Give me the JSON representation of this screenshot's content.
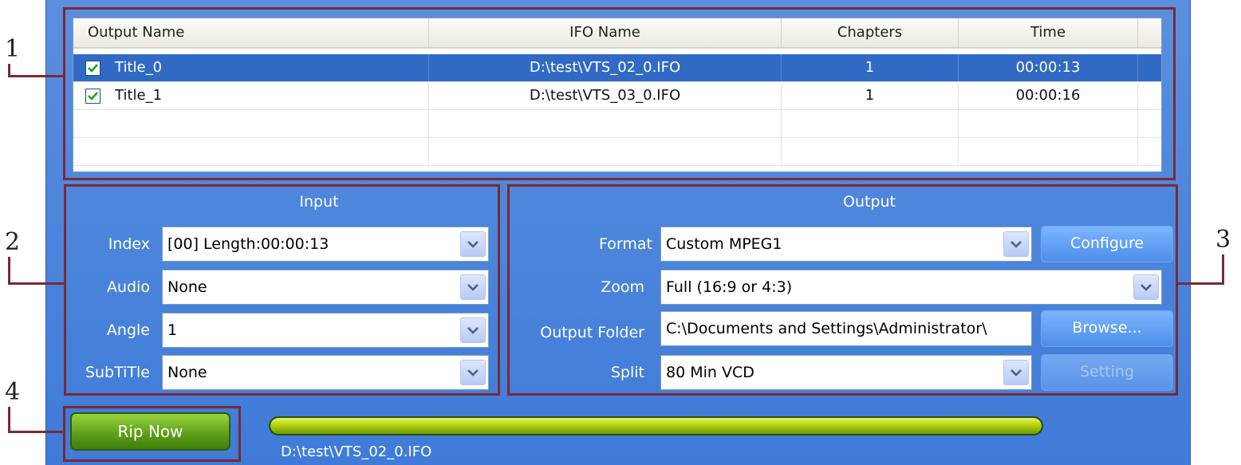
{
  "callouts": [
    "1",
    "2",
    "3",
    "4"
  ],
  "titles_table": {
    "columns": [
      "Output Name",
      "IFO Name",
      "Chapters",
      "Time"
    ],
    "rows": [
      {
        "checked": true,
        "selected": true,
        "name": "Title_0",
        "ifo": "D:\\test\\VTS_02_0.IFO",
        "chapters": "1",
        "time": "00:00:13"
      },
      {
        "checked": true,
        "selected": false,
        "name": "Title_1",
        "ifo": "D:\\test\\VTS_03_0.IFO",
        "chapters": "1",
        "time": "00:00:16"
      }
    ]
  },
  "input": {
    "title": "Input",
    "index_label": "Index",
    "index_value": "[00] Length:00:00:13",
    "audio_label": "Audio",
    "audio_value": "None",
    "angle_label": "Angle",
    "angle_value": "1",
    "subtitle_label": "SubTiTle",
    "subtitle_value": "None"
  },
  "output": {
    "title": "Output",
    "format_label": "Format",
    "format_value": "Custom MPEG1",
    "configure_label": "Configure",
    "zoom_label": "Zoom",
    "zoom_value": "Full (16:9 or 4:3)",
    "folder_label": "Output Folder",
    "folder_value": "C:\\Documents and Settings\\Administrator\\",
    "browse_label": "Browse...",
    "split_label": "Split",
    "split_value": "80 Min VCD",
    "setting_label": "Setting"
  },
  "rip": {
    "button_label": "Rip Now",
    "progress": 1.0,
    "status_text": "D:\\test\\VTS_02_0.IFO"
  },
  "colors": {
    "panel": "#3f7bd8",
    "selection": "#316ac5",
    "callout_line": "#7a2a35",
    "rip_button": "#5fa11a",
    "progress_fill": "#b4d40d"
  }
}
